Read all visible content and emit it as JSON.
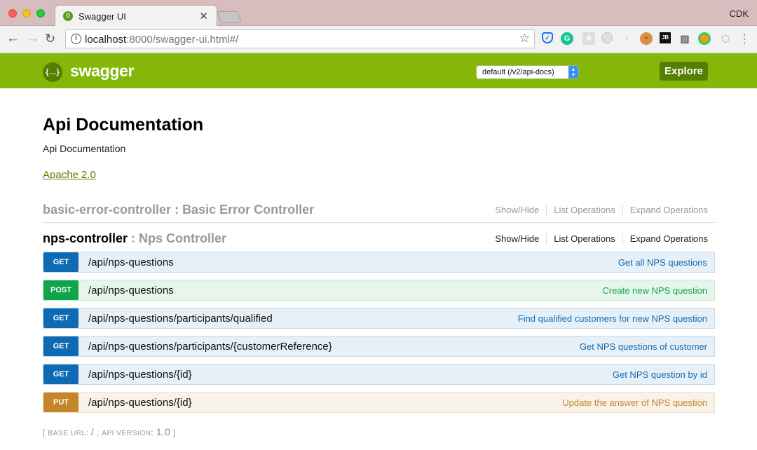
{
  "browser": {
    "tab_title": "Swagger UI",
    "profile_name": "CDK",
    "url_host": "localhost",
    "url_rest": ":8000/swagger-ui.html#/",
    "extensions": [
      "shield-icon",
      "grammarly-icon",
      "react-icon",
      "target-icon",
      "spinner-icon",
      "cookie-icon",
      "jetbrains-icon",
      "ruler-icon",
      "color-picker-icon",
      "privacy-badge-icon"
    ]
  },
  "header": {
    "logo_glyph": "{…}",
    "logo_text": "swagger",
    "spec_select_value": "default (/v2/api-docs)",
    "explore_label": "Explore",
    "brand_color": "#85b708"
  },
  "info": {
    "title": "Api Documentation",
    "description": "Api Documentation",
    "license": "Apache 2.0"
  },
  "resources": [
    {
      "name": "basic-error-controller",
      "separator": " : ",
      "description": "Basic Error Controller",
      "actions": [
        "Show/Hide",
        "List Operations",
        "Expand Operations"
      ]
    },
    {
      "name": "nps-controller",
      "separator": " : ",
      "description": "Nps Controller",
      "actions": [
        "Show/Hide",
        "List Operations",
        "Expand Operations"
      ]
    }
  ],
  "operations": [
    {
      "method": "GET",
      "path": "/api/nps-questions",
      "summary": "Get all NPS questions"
    },
    {
      "method": "POST",
      "path": "/api/nps-questions",
      "summary": "Create new NPS question"
    },
    {
      "method": "GET",
      "path": "/api/nps-questions/participants/qualified",
      "summary": "Find qualified customers for new NPS question"
    },
    {
      "method": "GET",
      "path": "/api/nps-questions/participants/{customerReference}",
      "summary": "Get NPS questions of customer"
    },
    {
      "method": "GET",
      "path": "/api/nps-questions/{id}",
      "summary": "Get NPS question by id"
    },
    {
      "method": "PUT",
      "path": "/api/nps-questions/{id}",
      "summary": "Update the answer of NPS question"
    }
  ],
  "method_colors": {
    "GET": "#0f6ab4",
    "POST": "#10a54a",
    "PUT": "#c5862b"
  },
  "footer": {
    "open": "[ ",
    "base_url_label": "Base URL",
    "base_url_value": "/",
    "comma": " , ",
    "api_version_label": "Api Version",
    "api_version_value": "1.0",
    "close": " ]"
  }
}
